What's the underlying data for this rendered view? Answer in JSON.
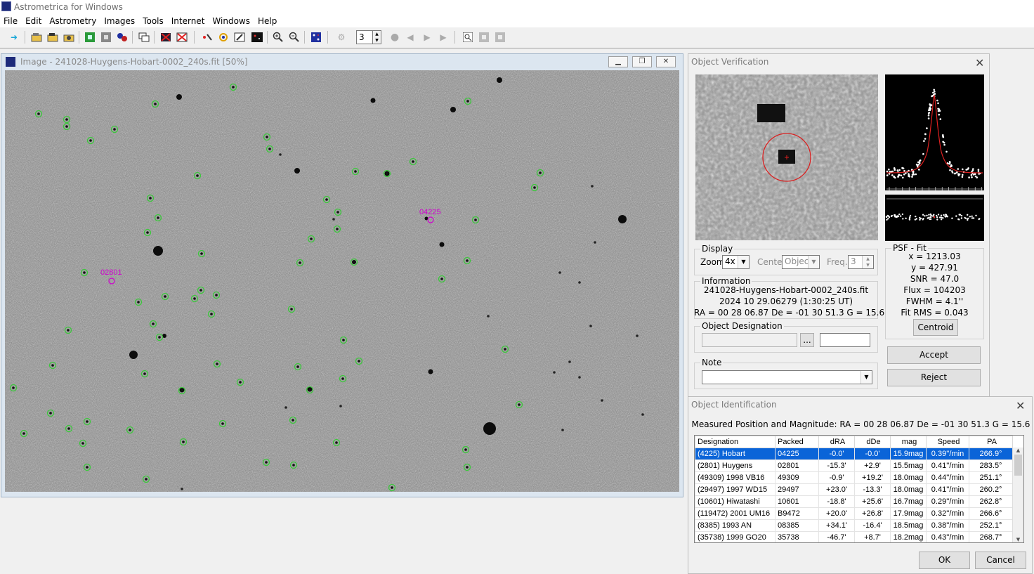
{
  "app": {
    "title": "Astrometrica for Windows"
  },
  "menu": [
    "File",
    "Edit",
    "Astrometry",
    "Images",
    "Tools",
    "Internet",
    "Windows",
    "Help"
  ],
  "toolbar": {
    "frame_value": "3"
  },
  "image_window": {
    "title": "Image - 241028-Huygens-Hobart-0002_240s.fit [50%]",
    "labels": {
      "hobart": "04225",
      "huygens": "02801"
    }
  },
  "verification": {
    "title": "Object Verification",
    "display_label": "Display",
    "zoom_label": "Zoom",
    "zoom_value": "4x",
    "center_label": "Center",
    "center_value": "Object",
    "freq_label": "Freq.",
    "freq_value": "3",
    "info_label": "Information",
    "info_file": "241028-Huygens-Hobart-0002_240s.fit",
    "info_date": "2024 10 29.06279 (1:30:25 UT)",
    "info_pos": "RA = 00 28 06.87   De = -01 30 51.3   G = 15.6",
    "desig_label": "Object Designation",
    "browse_label": "...",
    "note_label": "Note",
    "psf_label": "PSF - Fit",
    "psf": {
      "x": "x = 1213.03",
      "y": "y = 427.91",
      "snr": "SNR = 47.0",
      "flux": "Flux = 104203",
      "fwhm": "FWHM = 4.1''",
      "rms": "Fit RMS = 0.043"
    },
    "centroid_label": "Centroid",
    "accept_label": "Accept",
    "reject_label": "Reject"
  },
  "identification": {
    "title": "Object Identification",
    "measured": "Measured Position and Magnitude: RA = 00 28 06.87   De = -01 30 51.3   G = 15.6",
    "columns": [
      "Designation",
      "Packed",
      "dRA",
      "dDe",
      "mag",
      "Speed",
      "PA"
    ],
    "rows": [
      [
        "(4225) Hobart",
        "04225",
        "-0.0'",
        "-0.0'",
        "15.9mag",
        "0.39''/min",
        "266.9°"
      ],
      [
        "(2801) Huygens",
        "02801",
        "-15.3'",
        "+2.9'",
        "15.5mag",
        "0.41''/min",
        "283.5°"
      ],
      [
        "(49309) 1998 VB16",
        "49309",
        "-0.9'",
        "+19.2'",
        "18.0mag",
        "0.44''/min",
        "251.1°"
      ],
      [
        "(29497) 1997 WD15",
        "29497",
        "+23.0'",
        "-13.3'",
        "18.0mag",
        "0.41''/min",
        "260.2°"
      ],
      [
        "(10601) Hiwatashi",
        "10601",
        "-18.8'",
        "+25.6'",
        "16.7mag",
        "0.29''/min",
        "262.8°"
      ],
      [
        "(119472) 2001 UM16",
        "B9472",
        "+20.0'",
        "+26.8'",
        "17.9mag",
        "0.32''/min",
        "266.6°"
      ],
      [
        "(8385) 1993 AN",
        "08385",
        "+34.1'",
        "-16.4'",
        "18.5mag",
        "0.38''/min",
        "252.1°"
      ],
      [
        "(35738) 1999 GO20",
        "35738",
        "-46.7'",
        "+8.7'",
        "18.2mag",
        "0.43''/min",
        "268.7°"
      ]
    ],
    "ok_label": "OK",
    "cancel_label": "Cancel"
  }
}
